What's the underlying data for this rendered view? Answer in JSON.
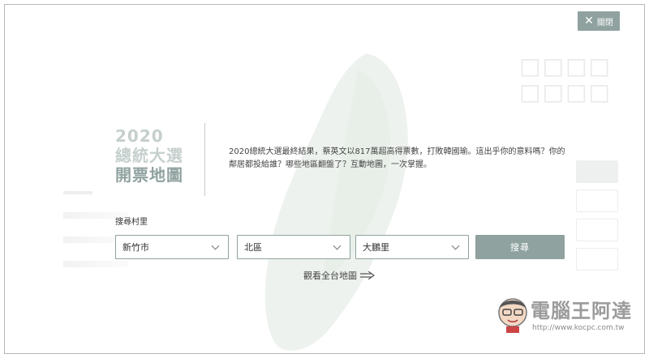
{
  "close_button": {
    "label": "關閉"
  },
  "heading": {
    "year": "2020",
    "line2": "總統大選",
    "line3": "開票地圖"
  },
  "description": "2020總統大選最終結果，蔡英文以817萬超高得票數，打敗韓國瑜。這出乎你的意料嗎？你的鄰居都投給誰？哪些地區翻盤了？互動地圖，一次掌握。",
  "search": {
    "label": "搜尋村里",
    "city": "新竹市",
    "district": "北區",
    "village": "大鵬里",
    "button": "搜尋"
  },
  "view_all": {
    "label": "觀看全台地圖"
  },
  "watermark": {
    "text": "電腦王阿達",
    "url": "http://www.kocpc.com.tw"
  },
  "colors": {
    "accent": "#8fa29f",
    "accent_light": "#c5cfcd",
    "border": "#b8b8b8"
  }
}
